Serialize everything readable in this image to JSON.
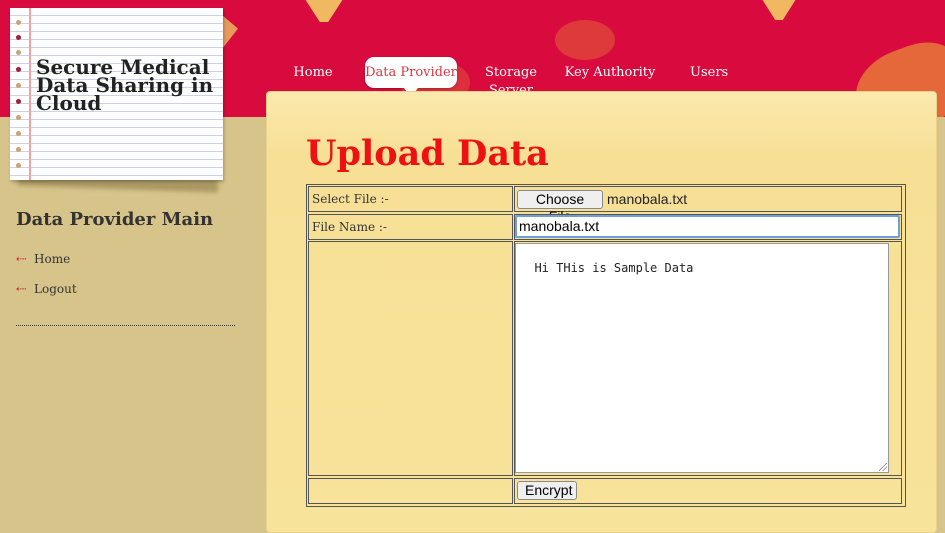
{
  "logo": {
    "title": "Secure Medical Data Sharing in Cloud"
  },
  "nav": {
    "items": [
      {
        "label": "Home"
      },
      {
        "label": "Data Provider",
        "active": true
      },
      {
        "label": "Storage\nServer"
      },
      {
        "label": "Key Authority"
      },
      {
        "label": "Users"
      }
    ]
  },
  "sidebar": {
    "title": "Data Provider Main",
    "links": [
      {
        "label": "Home",
        "icon": "arrow-bullet-icon"
      },
      {
        "label": "Logout",
        "icon": "arrow-bullet-icon"
      }
    ]
  },
  "main": {
    "title": "Upload Data",
    "form": {
      "select_file_label": "Select File :-",
      "choose_file_button": "Choose File",
      "chosen_file": "manobala.txt",
      "file_name_label": "File Name :-",
      "file_name_value": "manobala.txt",
      "content_value": "Hi THis is Sample Data",
      "encrypt_button": "Encrypt"
    }
  },
  "colors": {
    "header_red": "#d90a3e",
    "title_red": "#ee1111",
    "panel_yellow": "#f8e39a",
    "sidebar_tan": "#d7c48a"
  }
}
